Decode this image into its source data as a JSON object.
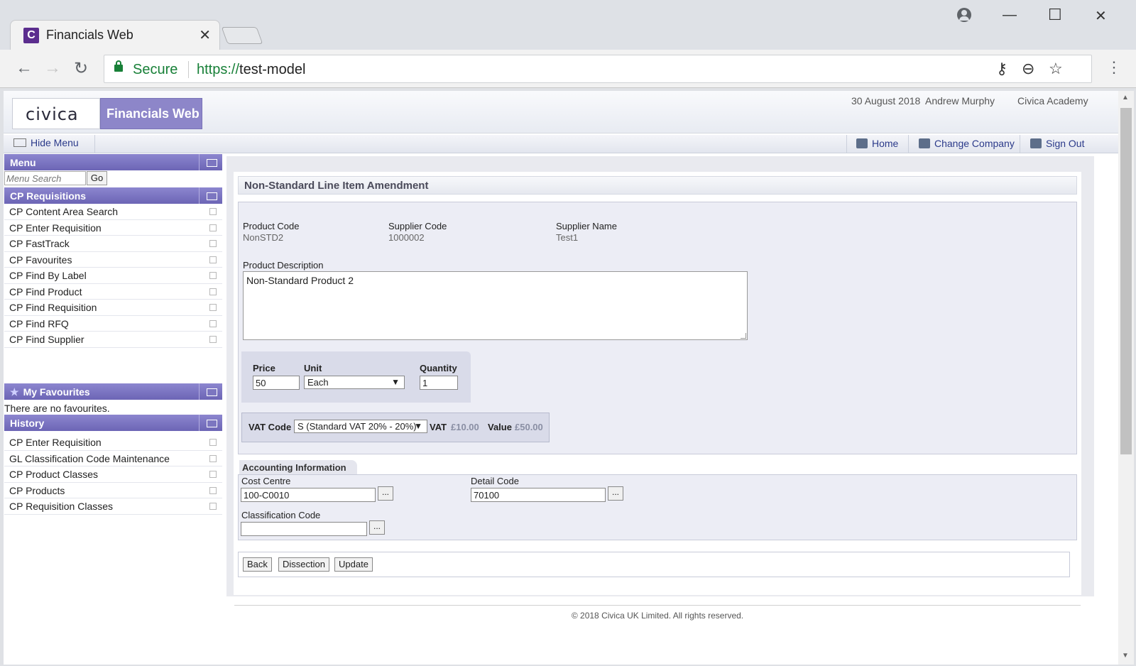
{
  "browser": {
    "tab_title": "Financials Web",
    "tab_favicon": "C",
    "secure_label": "Secure",
    "url_scheme": "https://",
    "url_host": "test-model"
  },
  "header": {
    "logo": "civica",
    "product": "Financials Web",
    "date": "30 August 2018",
    "user": "Andrew Murphy",
    "company": "Civica Academy"
  },
  "menubar": {
    "hide_menu": "Hide Menu",
    "home": "Home",
    "change_company": "Change Company",
    "sign_out": "Sign Out"
  },
  "sidebar": {
    "menu_title": "Menu",
    "search_placeholder": "Menu Search",
    "go": "Go",
    "requisitions_title": "CP Requisitions",
    "requisitions": [
      "CP Content Area Search",
      "CP Enter Requisition",
      "CP FastTrack",
      "CP Favourites",
      "CP Find By Label",
      "CP Find Product",
      "CP Find Requisition",
      "CP Find RFQ",
      "CP Find Supplier"
    ],
    "favourites_title": "My Favourites",
    "no_favourites": "There are no favourites.",
    "history_title": "History",
    "history": [
      "CP Enter Requisition",
      "GL Classification Code Maintenance",
      "CP Product Classes",
      "CP Products",
      "CP Requisition Classes"
    ]
  },
  "form": {
    "title": "Non-Standard Line Item Amendment",
    "product_code_label": "Product Code",
    "product_code": "NonSTD2",
    "supplier_code_label": "Supplier Code",
    "supplier_code": "1000002",
    "supplier_name_label": "Supplier Name",
    "supplier_name": "Test1",
    "description_label": "Product Description",
    "description": "Non-Standard Product 2",
    "price_label": "Price",
    "price": "50",
    "unit_label": "Unit",
    "unit": "Each",
    "quantity_label": "Quantity",
    "quantity": "1",
    "vat_code_label": "VAT Code",
    "vat_code": "S (Standard VAT 20% - 20%)",
    "vat_label": "VAT",
    "vat_value": "£10.00",
    "value_label": "Value",
    "value_amount": "£50.00"
  },
  "accounting": {
    "tab_label": "Accounting Information",
    "cost_centre_label": "Cost Centre",
    "cost_centre": "100-C0010",
    "detail_code_label": "Detail Code",
    "detail_code": "70100",
    "classification_label": "Classification Code",
    "classification": "",
    "lookup": "..."
  },
  "buttons": {
    "back": "Back",
    "dissection": "Dissection",
    "update": "Update"
  },
  "footer": "© 2018 Civica UK Limited. All rights reserved."
}
